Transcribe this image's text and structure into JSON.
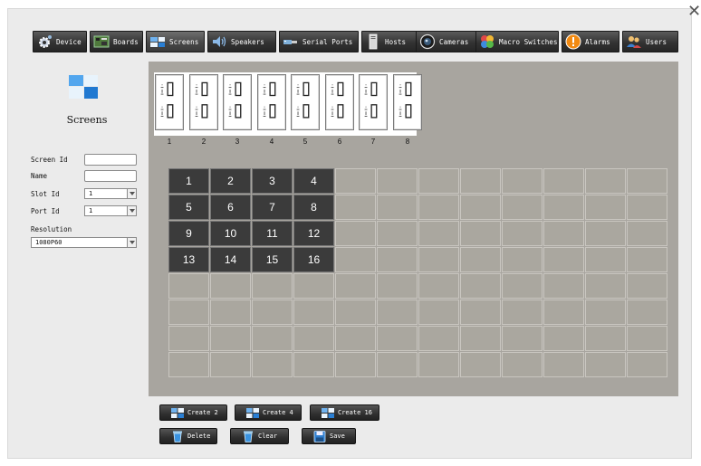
{
  "nav": {
    "tabs": [
      {
        "label": "Device",
        "icon": "gear-icon"
      },
      {
        "label": "Boards",
        "icon": "board-icon"
      },
      {
        "label": "Screens",
        "icon": "screens-icon",
        "active": true
      },
      {
        "label": "Speakers",
        "icon": "speaker-icon"
      },
      {
        "label": "Serial Ports",
        "icon": "serial-port-icon"
      },
      {
        "label": "Hosts",
        "icon": "host-icon"
      },
      {
        "label": "Cameras",
        "icon": "camera-icon"
      },
      {
        "label": "Macro Switches",
        "icon": "macro-switch-icon"
      },
      {
        "label": "Alarms",
        "icon": "alarm-icon"
      },
      {
        "label": "Users",
        "icon": "users-icon"
      }
    ]
  },
  "panel": {
    "title": "Screens",
    "screen_id": {
      "label": "Screen Id",
      "value": ""
    },
    "name": {
      "label": "Name",
      "value": ""
    },
    "slot_id": {
      "label": "Slot Id",
      "value": "1"
    },
    "port_id": {
      "label": "Port Id",
      "value": "1"
    },
    "resolution": {
      "label": "Resolution",
      "value": "1080P60"
    }
  },
  "ports": [
    "1",
    "2",
    "3",
    "4",
    "5",
    "6",
    "7",
    "8"
  ],
  "grid": {
    "rows": 8,
    "cols": 12,
    "assigned": [
      "1",
      "2",
      "3",
      "4",
      "5",
      "6",
      "7",
      "8",
      "9",
      "10",
      "11",
      "12",
      "13",
      "14",
      "15",
      "16"
    ]
  },
  "buttons": {
    "create2": "Create 2",
    "create4": "Create 4",
    "create16": "Create 16",
    "delete": "Delete",
    "clear": "Clear",
    "save": "Save"
  },
  "colors": {
    "accent": "#2a7fd4",
    "tab_bg": "#333333",
    "canvas": "#a8a59f",
    "assigned_cell": "#3b3b3b"
  }
}
